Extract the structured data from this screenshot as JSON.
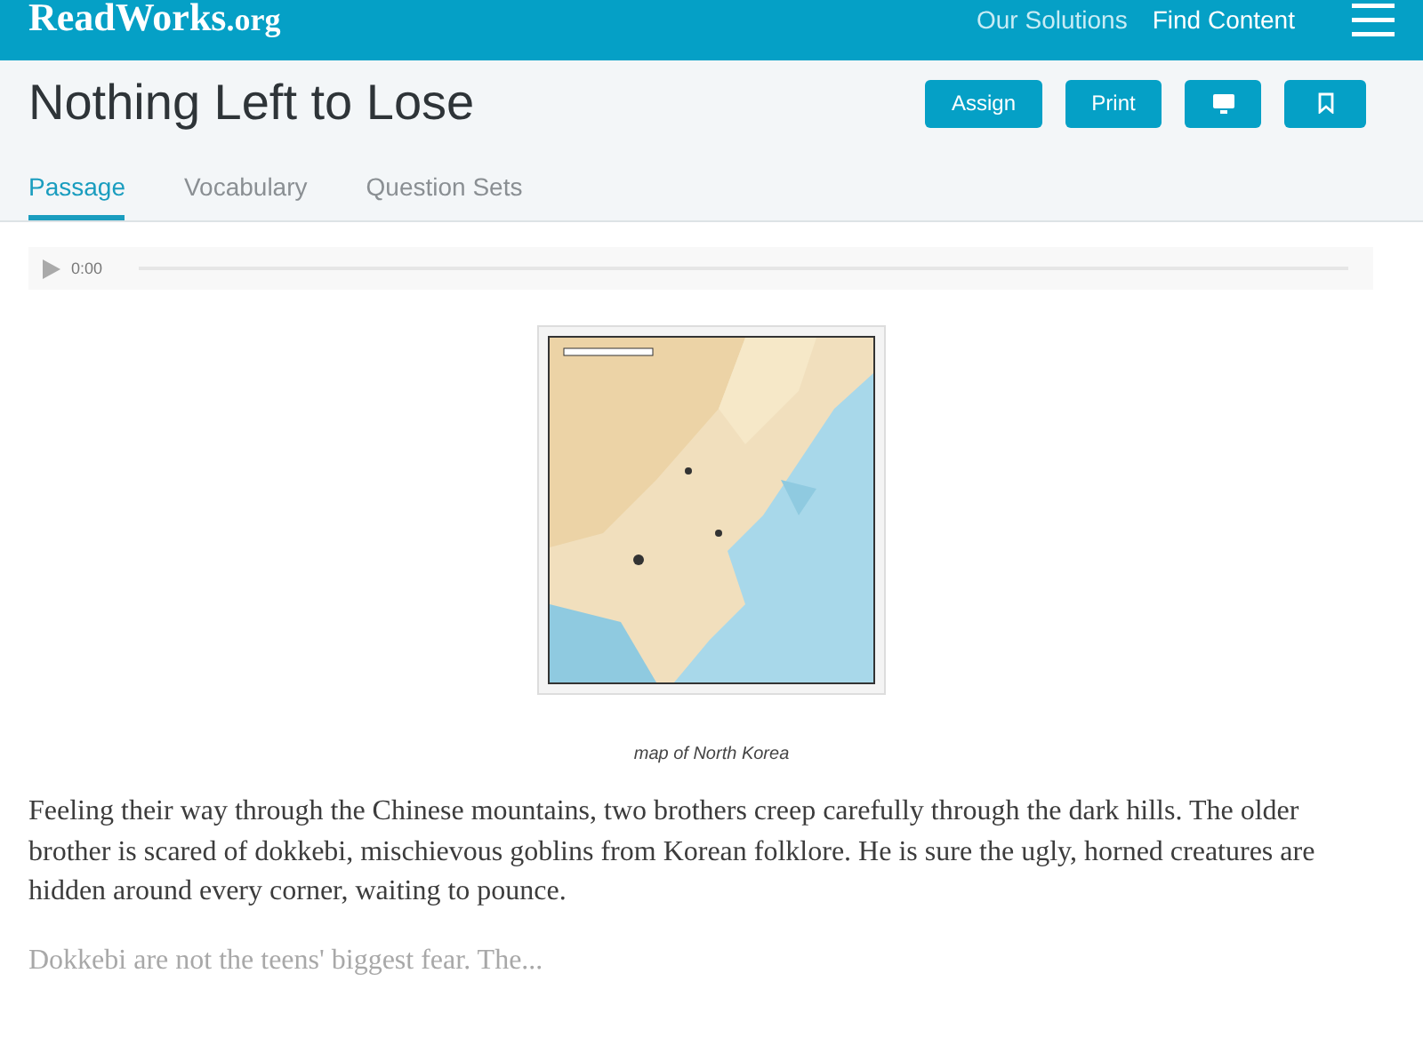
{
  "header": {
    "logo": "ReadWorks",
    "logo_suffix": ".org",
    "nav": [
      "Our Solutions",
      "Find Content"
    ]
  },
  "title": "Nothing Left to Lose",
  "actions": [
    {
      "kind": "text",
      "label": "Assign"
    },
    {
      "kind": "text",
      "label": "Print"
    },
    {
      "kind": "monitor"
    },
    {
      "kind": "bookmark"
    }
  ],
  "tabs": [
    {
      "label": "Passage",
      "selected": true
    },
    {
      "label": "Vocabulary",
      "selected": false
    },
    {
      "label": "Question Sets",
      "selected": false
    }
  ],
  "audio": {
    "time": "0:00"
  },
  "figure": {
    "kind": "picture",
    "caption": "map of North Korea"
  },
  "paragraphs": [
    "Feeling their way through the Chinese mountains, two brothers creep carefully through the dark hills. The older brother is scared of dokkebi, mischievous goblins from Korean folklore. He is sure the ugly, horned creatures are hidden around every corner, waiting to pounce.",
    "Dokkebi are not the teens' biggest fear. The..."
  ]
}
